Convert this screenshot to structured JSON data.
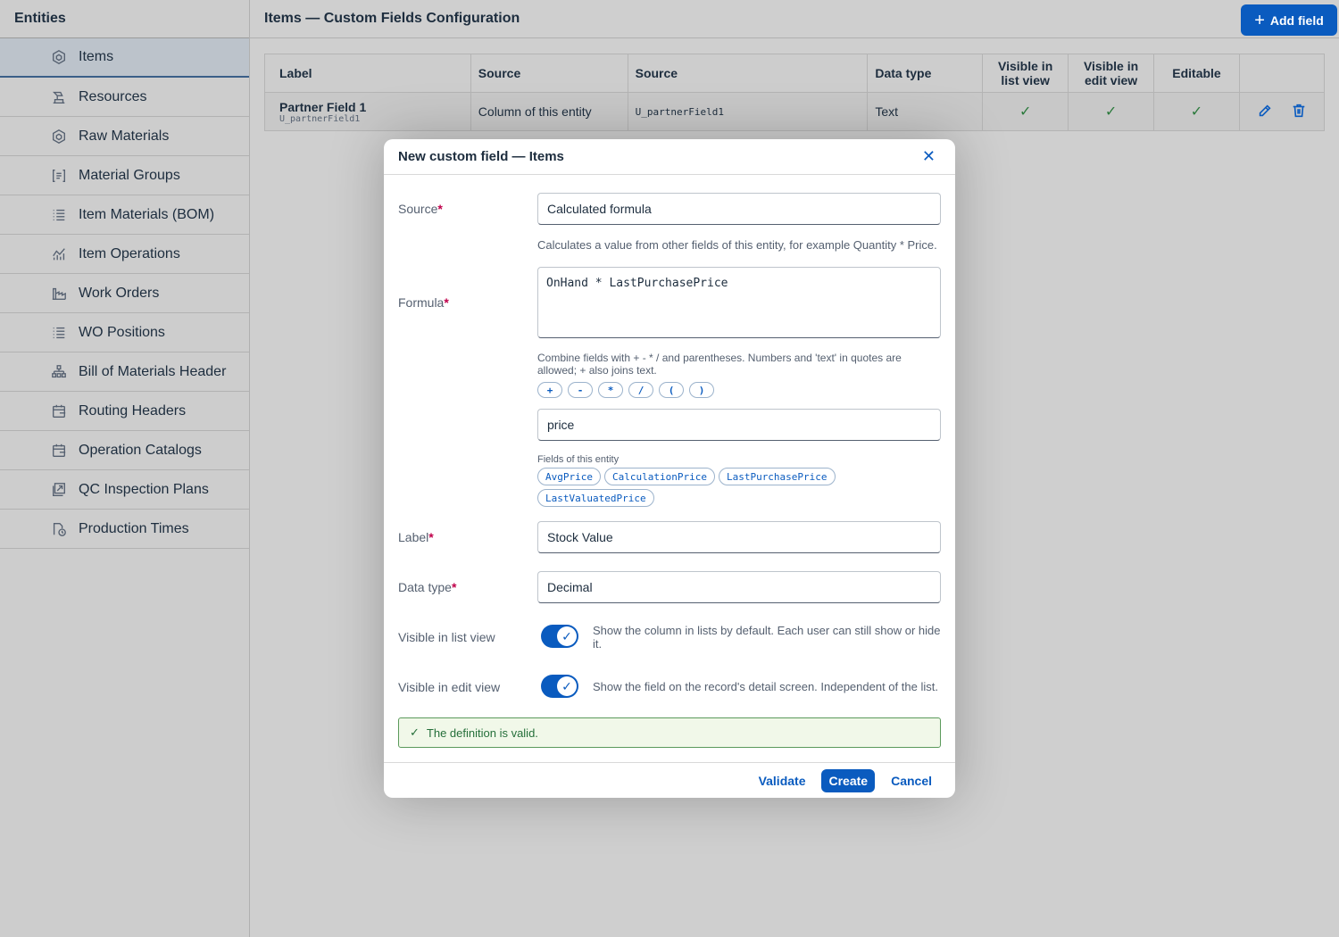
{
  "sidebar": {
    "title": "Entities",
    "items": [
      {
        "label": "Items",
        "icon": "cube-icon",
        "active": true
      },
      {
        "label": "Resources",
        "icon": "machine-icon"
      },
      {
        "label": "Raw Materials",
        "icon": "cube-icon"
      },
      {
        "label": "Material Groups",
        "icon": "group-icon"
      },
      {
        "label": "Item Materials (BOM)",
        "icon": "list-icon"
      },
      {
        "label": "Item Operations",
        "icon": "chart-icon"
      },
      {
        "label": "Work Orders",
        "icon": "factory-icon"
      },
      {
        "label": "WO Positions",
        "icon": "list-icon"
      },
      {
        "label": "Bill of Materials Header",
        "icon": "hierarchy-icon"
      },
      {
        "label": "Routing Headers",
        "icon": "calendar-icon"
      },
      {
        "label": "Operation Catalogs",
        "icon": "calendar-icon"
      },
      {
        "label": "QC Inspection Plans",
        "icon": "inspection-icon"
      },
      {
        "label": "Production Times",
        "icon": "clock-icon"
      }
    ]
  },
  "header": {
    "title": "Items — Custom Fields Configuration",
    "add_button": "Add field"
  },
  "table": {
    "columns": [
      "Label",
      "Source",
      "Source",
      "Data type",
      "Visible in list view",
      "Visible in edit view",
      "Editable"
    ],
    "rows": [
      {
        "label": "Partner Field 1",
        "field_id": "U_partnerField1",
        "source": "Column of this entity",
        "source_field": "U_partnerField1",
        "data_type": "Text",
        "visible_list": "✓",
        "visible_edit": "✓",
        "editable": "✓"
      }
    ]
  },
  "dialog": {
    "title": "New custom field — Items",
    "source_label": "Source",
    "source_value": "Calculated formula",
    "source_help": "Calculates a value from other fields of this entity, for example Quantity * Price.",
    "formula_label": "Formula",
    "formula_value": "OnHand * LastPurchasePrice",
    "formula_help": "Combine fields with + - * / and parentheses. Numbers and 'text' in quotes are allowed; + also joins text.",
    "operators": [
      "+",
      "-",
      "*",
      "/",
      "(",
      ")"
    ],
    "search_value": "price",
    "fields_caption": "Fields of this entity",
    "fields": [
      "AvgPrice",
      "CalculationPrice",
      "LastPurchasePrice",
      "LastValuatedPrice"
    ],
    "label_label": "Label",
    "label_value": "Stock Value",
    "datatype_label": "Data type",
    "datatype_value": "Decimal",
    "visible_list_label": "Visible in list view",
    "visible_list_desc": "Show the column in lists by default. Each user can still show or hide it.",
    "visible_list_on": true,
    "visible_edit_label": "Visible in edit view",
    "visible_edit_desc": "Show the field on the record's detail screen. Independent of the list.",
    "visible_edit_on": true,
    "validation_message": "The definition is valid.",
    "required_mark": "*",
    "buttons": {
      "validate": "Validate",
      "create": "Create",
      "cancel": "Cancel"
    }
  },
  "colors": {
    "accent": "#0a5bbf",
    "required": "#c0004a",
    "success": "#256f3a"
  }
}
